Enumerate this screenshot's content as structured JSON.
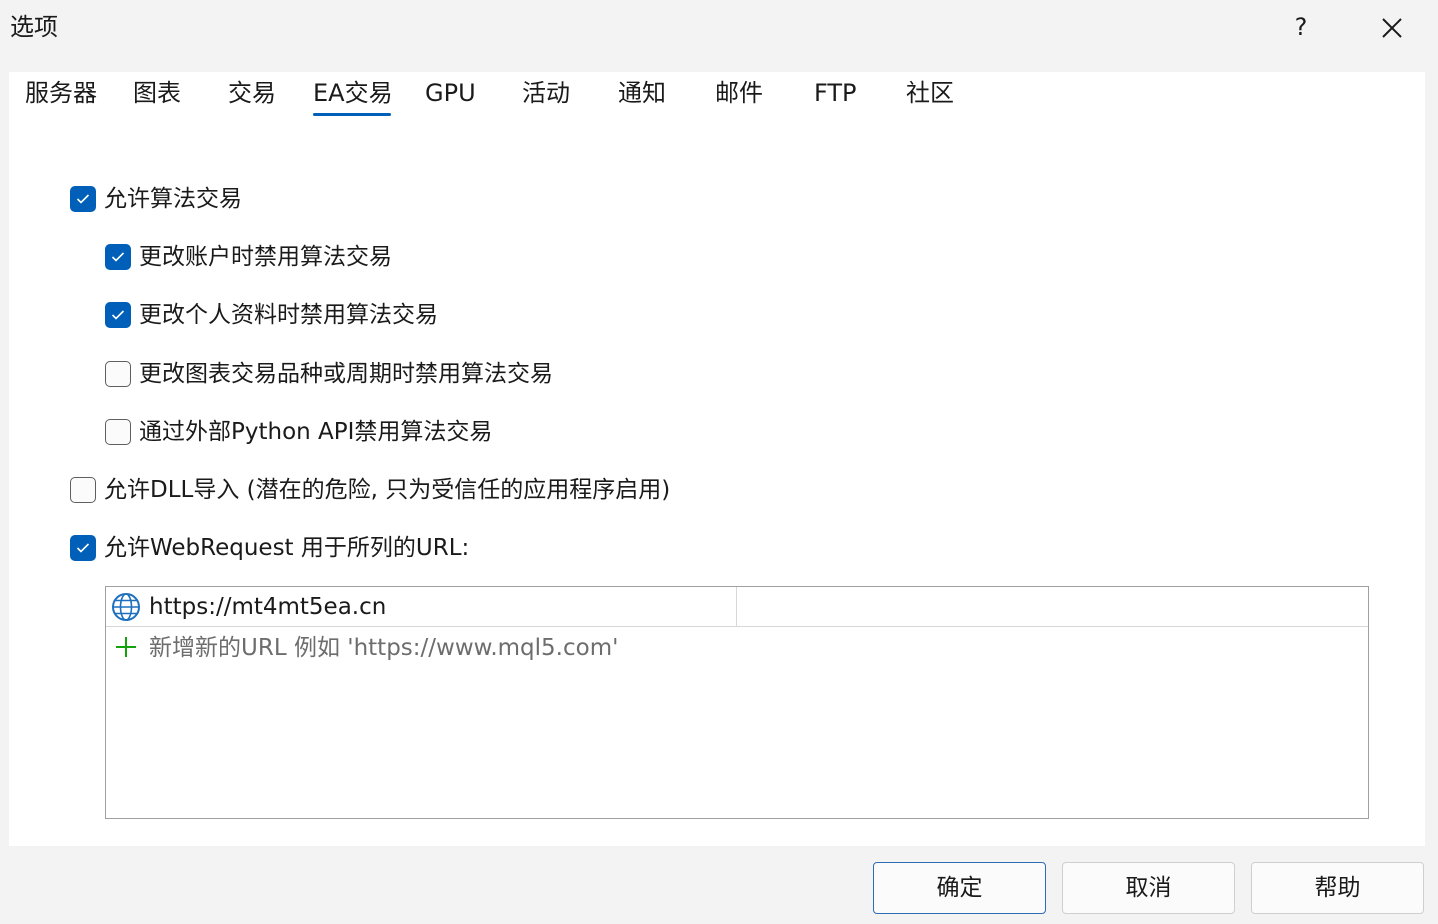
{
  "window": {
    "title": "选项",
    "help_label": "?"
  },
  "tabs": [
    {
      "label": "服务器"
    },
    {
      "label": "图表"
    },
    {
      "label": "交易"
    },
    {
      "label": "EA交易",
      "active": true
    },
    {
      "label": "GPU"
    },
    {
      "label": "活动"
    },
    {
      "label": "通知"
    },
    {
      "label": "邮件"
    },
    {
      "label": "FTP"
    },
    {
      "label": "社区"
    }
  ],
  "options": {
    "allow_algo": {
      "label": "允许算法交易",
      "checked": true
    },
    "disable_on_account_change": {
      "label": "更改账户时禁用算法交易",
      "checked": true
    },
    "disable_on_profile_change": {
      "label": "更改个人资料时禁用算法交易",
      "checked": true
    },
    "disable_on_symbol_change": {
      "label": "更改图表交易品种或周期时禁用算法交易",
      "checked": false
    },
    "disable_via_python": {
      "label": "通过外部Python API禁用算法交易",
      "checked": false
    },
    "allow_dll": {
      "label": "允许DLL导入 (潜在的危险, 只为受信任的应用程序启用)",
      "checked": false
    },
    "allow_webrequest": {
      "label": "允许WebRequest 用于所列的URL:",
      "checked": true
    }
  },
  "url_list": {
    "items": [
      {
        "url": "https://mt4mt5ea.cn",
        "icon": "globe-icon"
      }
    ],
    "add_placeholder": "新增新的URL 例如 'https://www.mql5.com'"
  },
  "buttons": {
    "ok": "确定",
    "cancel": "取消",
    "help": "帮助"
  },
  "colors": {
    "accent": "#005fb8",
    "add_green": "#13a10e",
    "globe_blue": "#1f6fbf"
  }
}
